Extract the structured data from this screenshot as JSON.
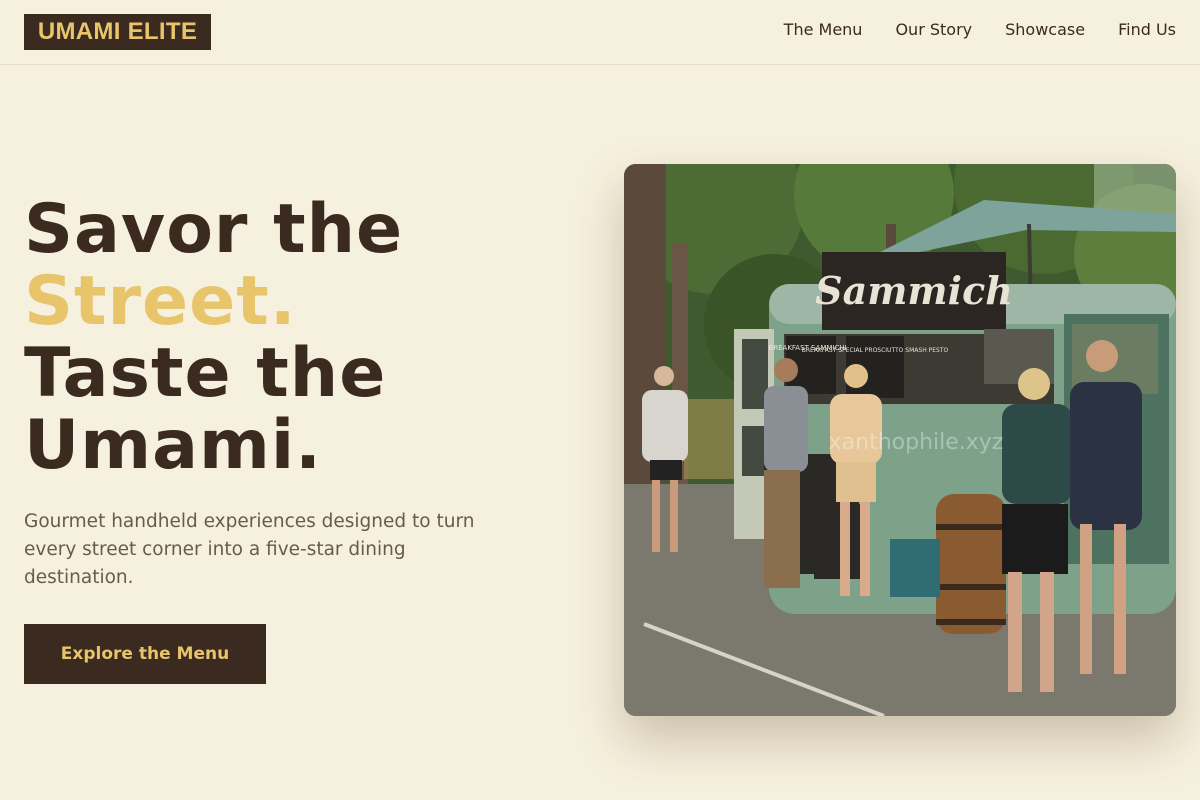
{
  "brand": {
    "logo_text": "UMAMI ELITE"
  },
  "nav": {
    "items": [
      {
        "label": "The Menu"
      },
      {
        "label": "Our Story"
      },
      {
        "label": "Showcase"
      },
      {
        "label": "Find Us"
      }
    ]
  },
  "hero": {
    "headline": {
      "line1": "Savor the",
      "line2": "Street.",
      "line3": "Taste the",
      "line4": "Umami."
    },
    "subtext": "Gourmet handheld experiences designed to turn every street corner into a five-star dining destination.",
    "cta_label": "Explore the Menu"
  },
  "photo": {
    "truck_sign": "Sammich",
    "board1_text": "BREAKFAST SAMMICHES",
    "board2_text": "BREAKFAST SPECIAL PROSCIUTTO SMASH PESTO",
    "watermark": "xanthophile.xyz"
  },
  "colors": {
    "background": "#f6f0de",
    "dark_brown": "#3b2a20",
    "accent_gold": "#e8c46a",
    "muted_text": "#6a5a4e"
  }
}
